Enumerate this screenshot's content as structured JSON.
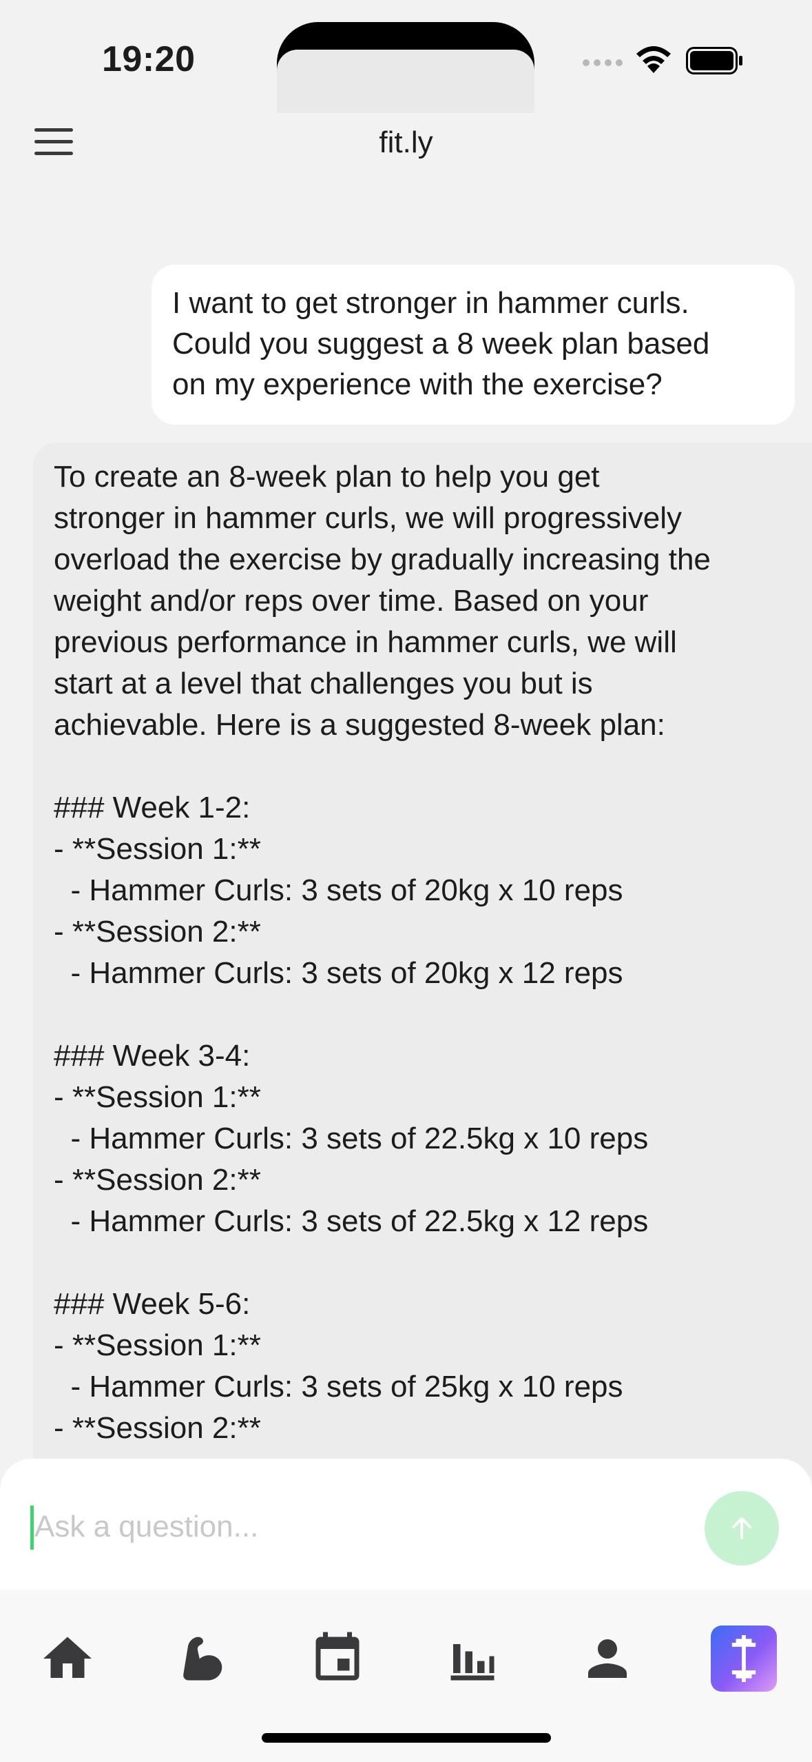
{
  "status_bar": {
    "time": "19:20"
  },
  "header": {
    "title": "fit.ly"
  },
  "chat": {
    "user_message": "I want to get stronger in hammer curls.\nCould you suggest a 8 week plan based\non my experience with the exercise?",
    "ai_message": "To create an 8-week plan to help you get\nstronger in hammer curls, we will progressively\noverload the exercise by gradually increasing the\nweight and/or reps over time. Based on your\nprevious performance in hammer curls, we will\nstart at a level that challenges you but is\nachievable. Here is a suggested 8-week plan:\n\n### Week 1-2:\n- **Session 1:**\n  - Hammer Curls: 3 sets of 20kg x 10 reps\n- **Session 2:**\n  - Hammer Curls: 3 sets of 20kg x 12 reps\n\n### Week 3-4:\n- **Session 1:**\n  - Hammer Curls: 3 sets of 22.5kg x 10 reps\n- **Session 2:**\n  - Hammer Curls: 3 sets of 22.5kg x 12 reps\n\n### Week 5-6:\n- **Session 1:**\n  - Hammer Curls: 3 sets of 25kg x 10 reps\n- **Session 2:**"
  },
  "composer": {
    "placeholder": "Ask a question..."
  },
  "tab_bar": {
    "items": [
      {
        "icon": "home-icon"
      },
      {
        "icon": "flexed-arm-icon"
      },
      {
        "icon": "calendar-icon"
      },
      {
        "icon": "bar-chart-icon"
      },
      {
        "icon": "person-icon"
      },
      {
        "icon": "dumbbell-icon",
        "active": true
      }
    ]
  },
  "colors": {
    "background": "#f2f2f3",
    "ai_bubble": "#ececed",
    "send_button": "#c6f2d2",
    "caret": "#3fd16c",
    "icon": "#3a3a3c"
  }
}
